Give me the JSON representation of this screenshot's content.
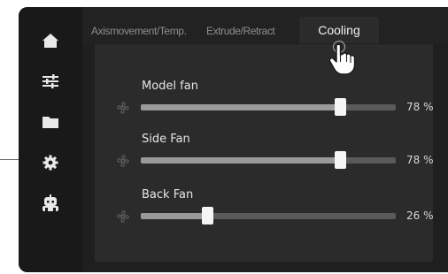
{
  "sidebar": {
    "items": [
      {
        "icon": "home-icon"
      },
      {
        "icon": "sliders-icon"
      },
      {
        "icon": "folder-icon"
      },
      {
        "icon": "gear-icon"
      },
      {
        "icon": "robot-icon"
      }
    ]
  },
  "tabs": [
    {
      "label": "Axismovement/Temp."
    },
    {
      "label": "Extrude/Retract"
    },
    {
      "label": "Cooling",
      "active": true
    }
  ],
  "fans": [
    {
      "label": "Model  fan",
      "value": 78,
      "value_text": "78 %",
      "icon": "fan-icon"
    },
    {
      "label": "Side Fan",
      "value": 78,
      "value_text": "78 %",
      "icon": "fan-icon"
    },
    {
      "label": "Back Fan",
      "value": 26,
      "value_text": "26 %",
      "icon": "fan-icon"
    }
  ],
  "colors": {
    "background": "#1f1f1f",
    "panel": "#2b2b2b",
    "track": "#5a5a5a",
    "fill": "#9a9a9a",
    "thumb": "#f5f5f5"
  }
}
